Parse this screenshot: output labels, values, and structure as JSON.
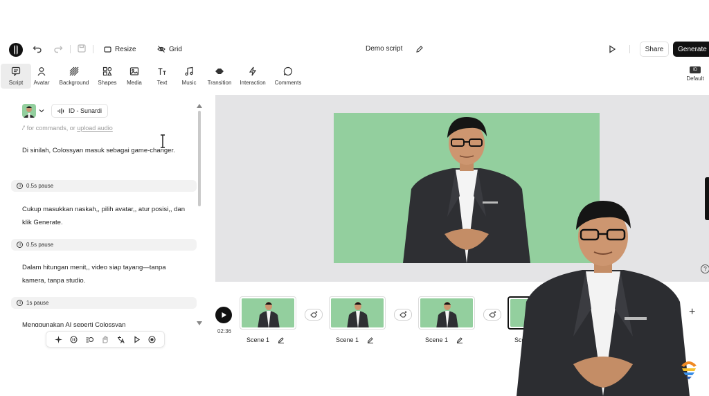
{
  "header": {
    "resize_label": "Resize",
    "grid_label": "Grid",
    "title": "Demo script",
    "share_label": "Share",
    "generate_label": "Generate"
  },
  "tools": [
    {
      "label": "Script",
      "icon": "script-icon"
    },
    {
      "label": "Avatar",
      "icon": "avatar-icon"
    },
    {
      "label": "Background",
      "icon": "background-icon"
    },
    {
      "label": "Shapes",
      "icon": "shapes-icon"
    },
    {
      "label": "Media",
      "icon": "media-icon"
    },
    {
      "label": "Text",
      "icon": "text-icon"
    },
    {
      "label": "Music",
      "icon": "music-icon"
    },
    {
      "label": "Transition",
      "icon": "transition-icon"
    },
    {
      "label": "Interaction",
      "icon": "interaction-icon"
    },
    {
      "label": "Comments",
      "icon": "comments-icon"
    }
  ],
  "layout_badge": {
    "tag": "ID",
    "label": "Default"
  },
  "script": {
    "voice": "ID - Sunardi",
    "placeholder_prefix": "/' for commands, or ",
    "placeholder_link": "upload audio",
    "paragraphs": [
      "Di sinilah, Colossyan masuk sebagai game-changer.",
      "Cukup masukkan naskah,, pilih avatar,, atur posisi,, dan klik Generate.",
      "Dalam hitungan menit,, video siap tayang—tanpa kamera, tanpa studio.",
      "Menggunakan AI seperti Colossyan"
    ],
    "pauses": [
      "0.5s pause",
      "0.5s pause",
      "1s pause"
    ]
  },
  "timeline": {
    "duration": "02:36",
    "scenes": [
      {
        "label": "Scene 1"
      },
      {
        "label": "Scene 1"
      },
      {
        "label": "Scene 1"
      },
      {
        "label": "Sce"
      }
    ]
  },
  "colors": {
    "accent": "#111111",
    "greenscreen": "#93cf9e",
    "canvas_bg": "#e4e4e6"
  }
}
